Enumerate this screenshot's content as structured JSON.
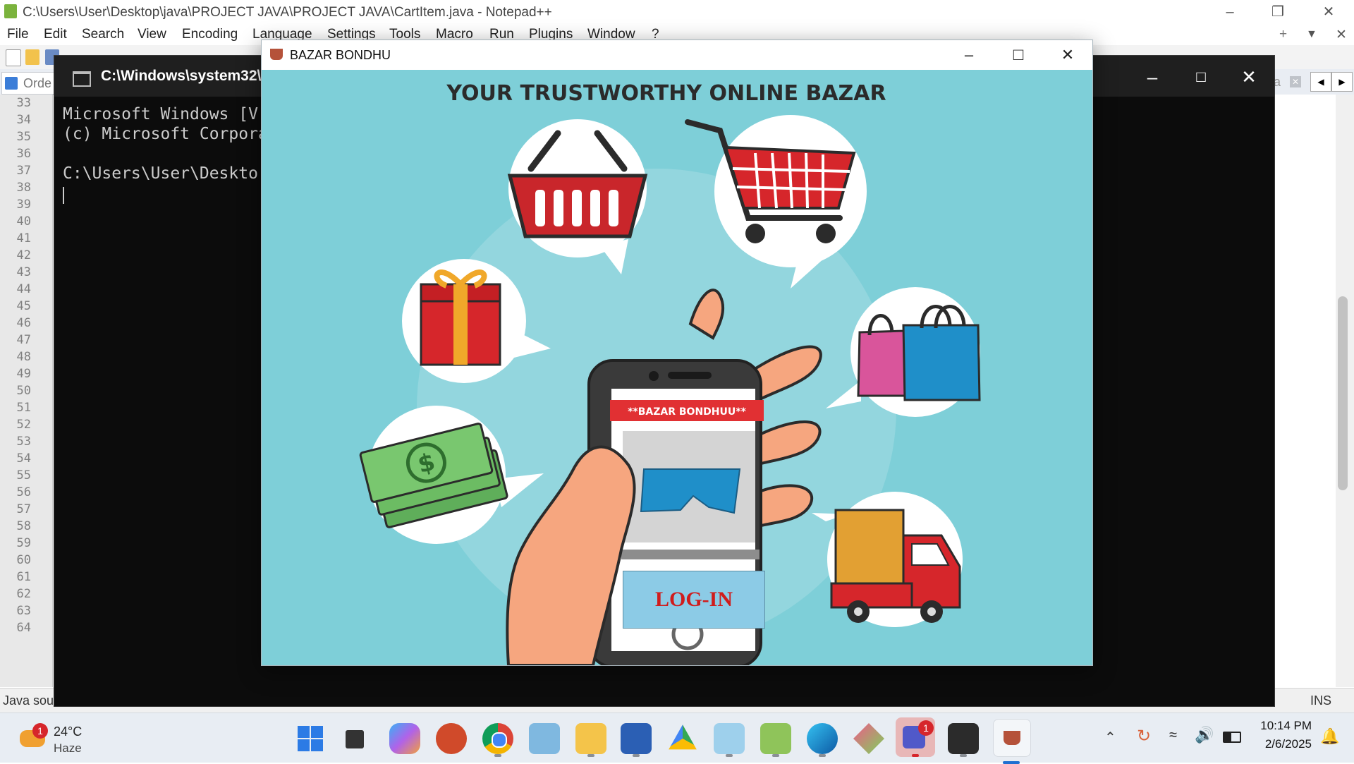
{
  "notepad": {
    "title": "C:\\Users\\User\\Desktop\\java\\PROJECT JAVA\\PROJECT JAVA\\CartItem.java - Notepad++",
    "menu": [
      "File",
      "Edit",
      "Search",
      "View",
      "Encoding",
      "Language",
      "Settings",
      "Tools",
      "Macro",
      "Run",
      "Plugins",
      "Window",
      "?"
    ],
    "tab_left": "Orde",
    "tab_right": "a",
    "line_numbers": [
      "33",
      "34",
      "35",
      "36",
      "37",
      "38",
      "39",
      "40",
      "41",
      "42",
      "43",
      "44",
      "45",
      "46",
      "47",
      "48",
      "49",
      "50",
      "51",
      "52",
      "53",
      "54",
      "55",
      "56",
      "57",
      "58",
      "59",
      "60",
      "61",
      "62",
      "63",
      "64"
    ],
    "status_left": "Java sou",
    "status_right": "INS"
  },
  "cmd": {
    "title": "C:\\Windows\\system32\\c",
    "lines": [
      "Microsoft Windows [V",
      "(c) Microsoft Corpora",
      "",
      "C:\\Users\\User\\Deskto"
    ]
  },
  "app": {
    "title": "BAZAR BONDHU",
    "headline": "YOUR TRUSTWORTHY ONLINE BAZAR",
    "phone_banner": "**BAZAR BONDHUU**",
    "login_button": "LOG-IN"
  },
  "taskbar": {
    "weather_temp": "24°C",
    "weather_desc": "Haze",
    "weather_badge": "1",
    "teams_badge": "1",
    "time": "10:14 PM",
    "date": "2/6/2025"
  },
  "colors": {
    "app_bg": "#7ecfd8",
    "accent_red": "#d6262b",
    "login_bg": "#8ccbe6",
    "login_text": "#d01c1c"
  }
}
